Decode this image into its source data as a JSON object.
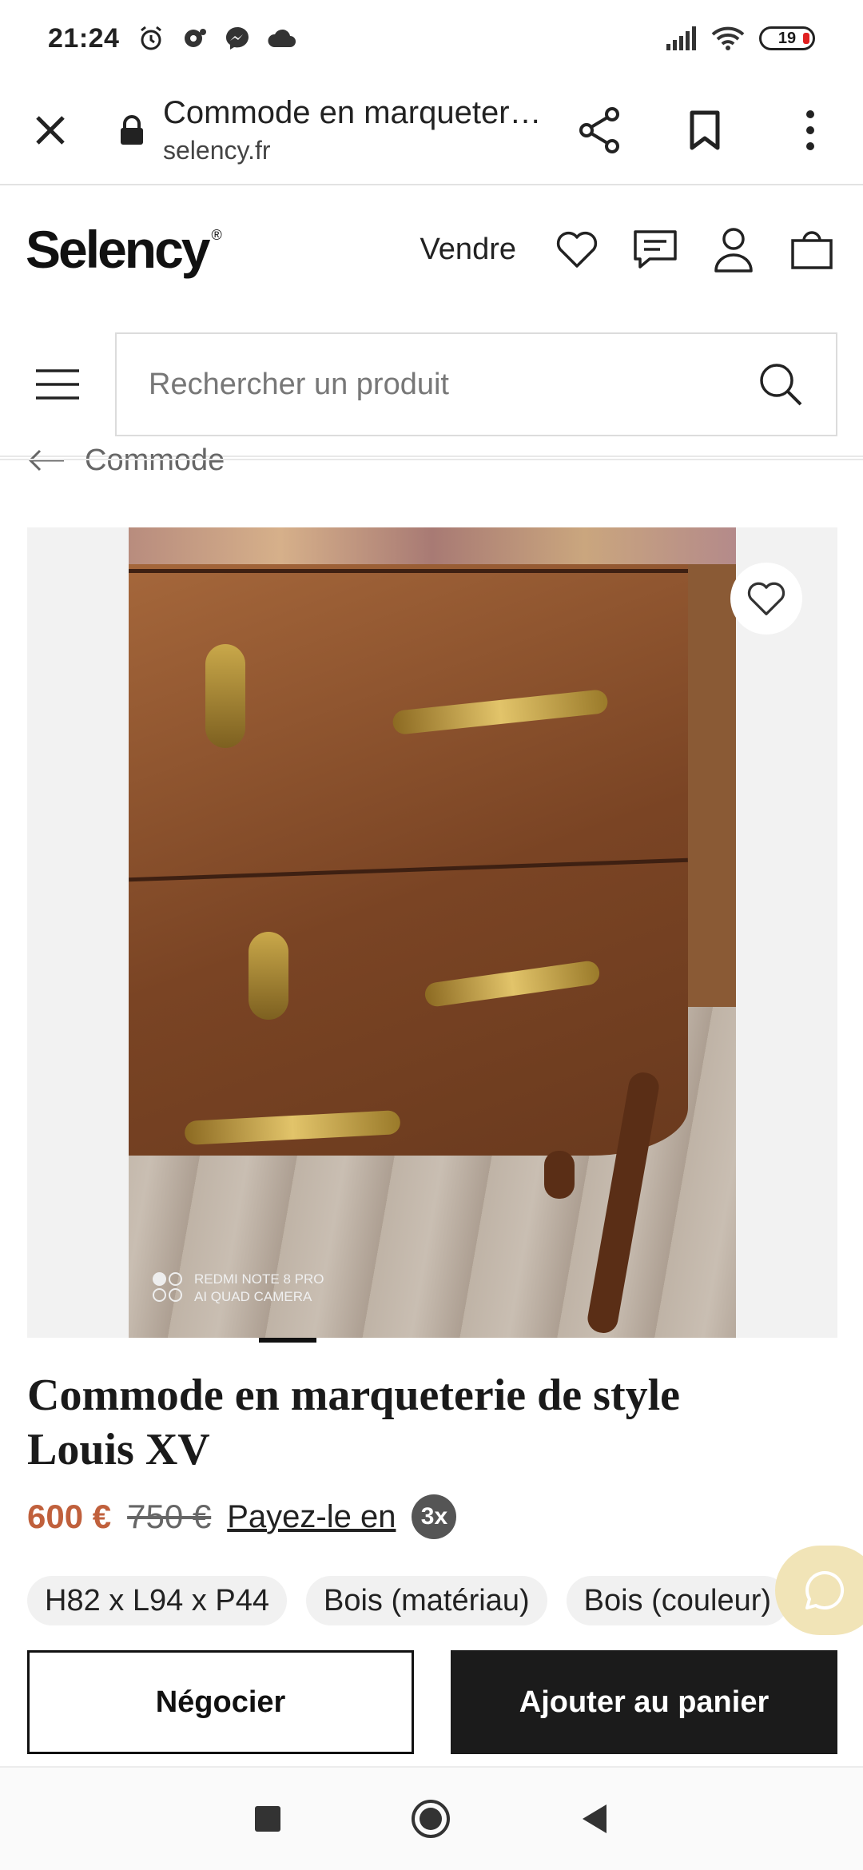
{
  "status_bar": {
    "time": "21:24",
    "battery": "19",
    "icons_left": [
      "alarm-icon",
      "notification-icon",
      "messenger-icon",
      "cloud-icon"
    ],
    "icons_right": [
      "signal-icon",
      "wifi-icon",
      "battery-icon"
    ]
  },
  "browser": {
    "page_title": "Commode en marqueterie de style Louis XV",
    "domain": "selency.fr"
  },
  "header": {
    "logo": "Selency",
    "logo_mark": "®",
    "sell_label": "Vendre"
  },
  "search": {
    "placeholder": "Rechercher un produit"
  },
  "breadcrumb": {
    "label": "Commode"
  },
  "gallery": {
    "camera_line1": "REDMI NOTE 8 PRO",
    "camera_line2": "AI QUAD CAMERA",
    "current_slide": 1
  },
  "product": {
    "title": "Commode en marqueterie de style Louis XV",
    "price": "600 €",
    "old_price": "750 €",
    "pay_label": "Payez-le en",
    "pay_badge": "3x",
    "chips": [
      "H82 x L94 x P44",
      "Bois (matériau)",
      "Bois (couleur)"
    ]
  },
  "actions": {
    "negotiate": "Négocier",
    "add_to_cart": "Ajouter au panier"
  },
  "colors": {
    "price": "#c0603c",
    "cta_dark": "#1b1b1b",
    "chat_fab": "#f1e4b7"
  }
}
